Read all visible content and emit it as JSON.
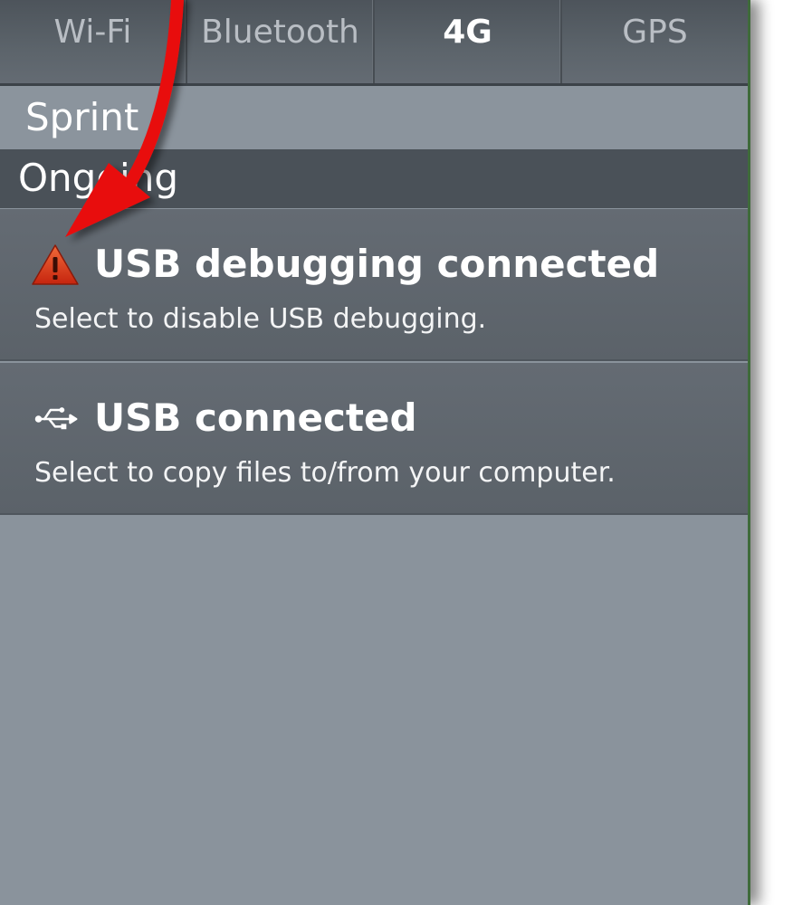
{
  "quick_toggles": [
    {
      "label": "Wi-Fi",
      "active": false
    },
    {
      "label": "Bluetooth",
      "active": false
    },
    {
      "label": "4G",
      "active": true
    },
    {
      "label": "GPS",
      "active": false
    }
  ],
  "carrier": "Sprint",
  "section_header": "Ongoing",
  "notifications": [
    {
      "icon": "warning-icon",
      "title": "USB debugging connected",
      "subtitle": "Select to disable USB debugging."
    },
    {
      "icon": "usb-icon",
      "title": "USB connected",
      "subtitle": "Select to copy files to/from your computer."
    }
  ],
  "colors": {
    "panel_background": "#8a939c",
    "section_header": "#4a5158",
    "annotation_arrow": "#e8110f",
    "warning_icon": "#d9391a"
  }
}
